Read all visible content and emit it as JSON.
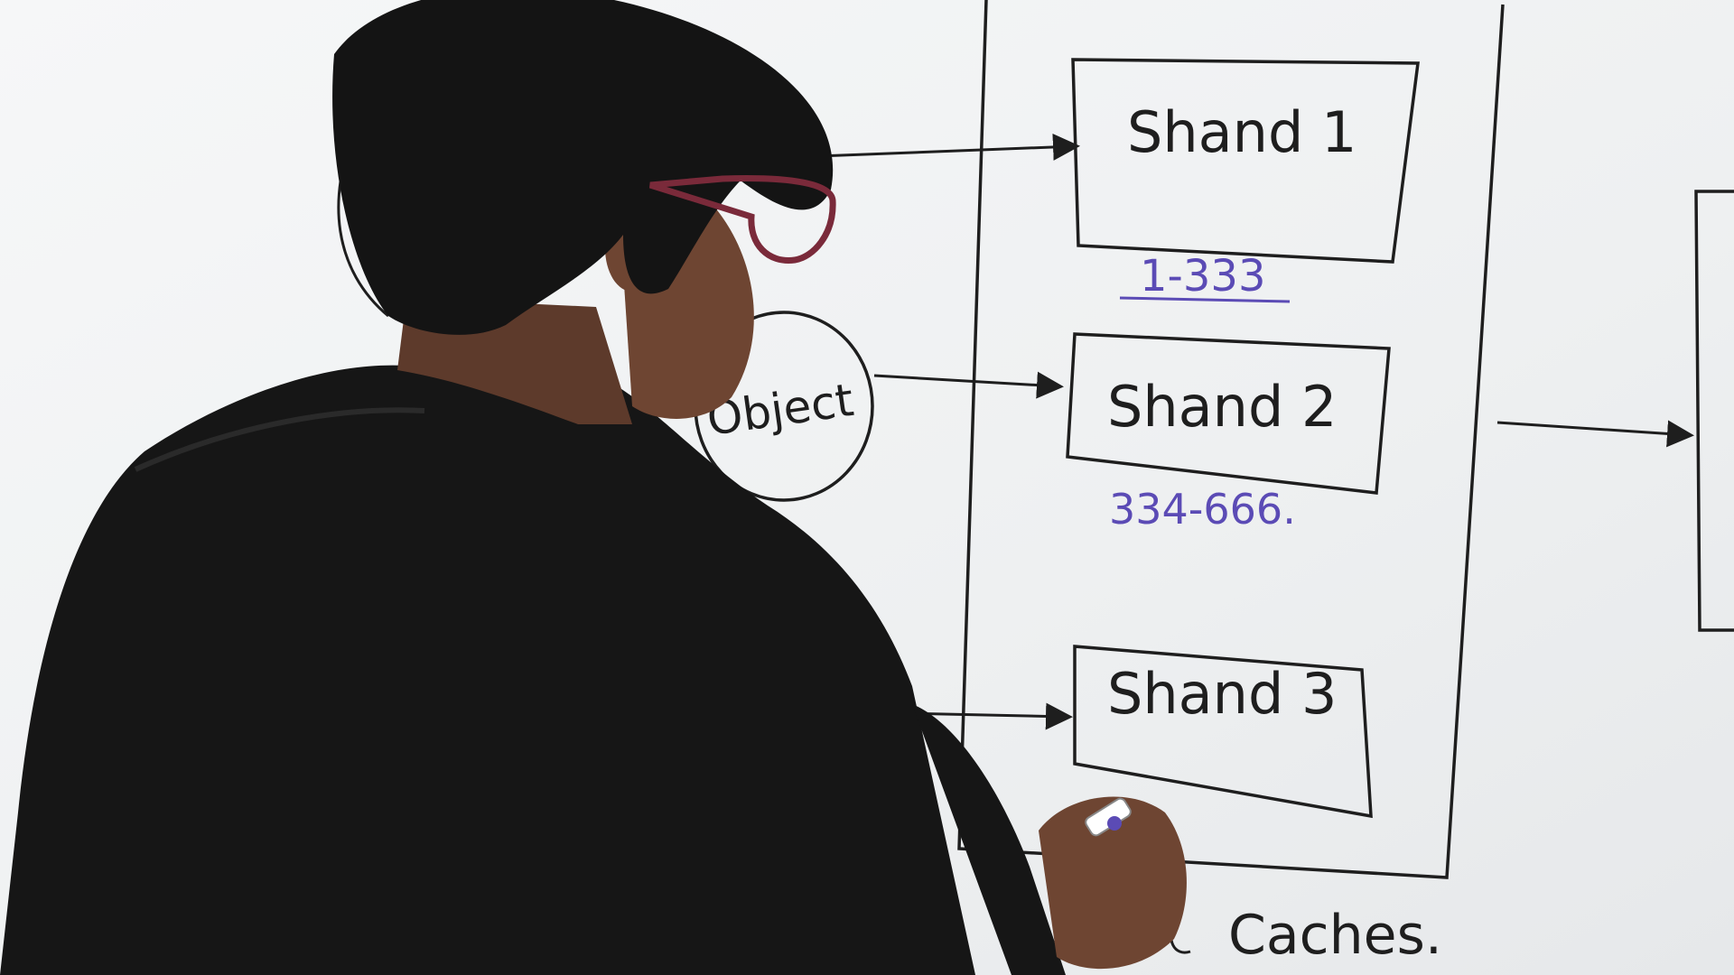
{
  "whiteboard": {
    "shards": [
      {
        "label": "Shand 1",
        "range": "1-333"
      },
      {
        "label": "Shand 2",
        "range": "334-666."
      },
      {
        "label": "Shand 3",
        "range": ""
      }
    ],
    "object_label": "Object",
    "caption": "Caches."
  },
  "colors": {
    "ink_black": "#1e1e1e",
    "ink_purple": "#5b4bb5",
    "board": "#f4f6f7",
    "shirt": "#161616",
    "hair": "#141414",
    "skin": "#6e4532",
    "glasses": "#7a2a3a"
  }
}
